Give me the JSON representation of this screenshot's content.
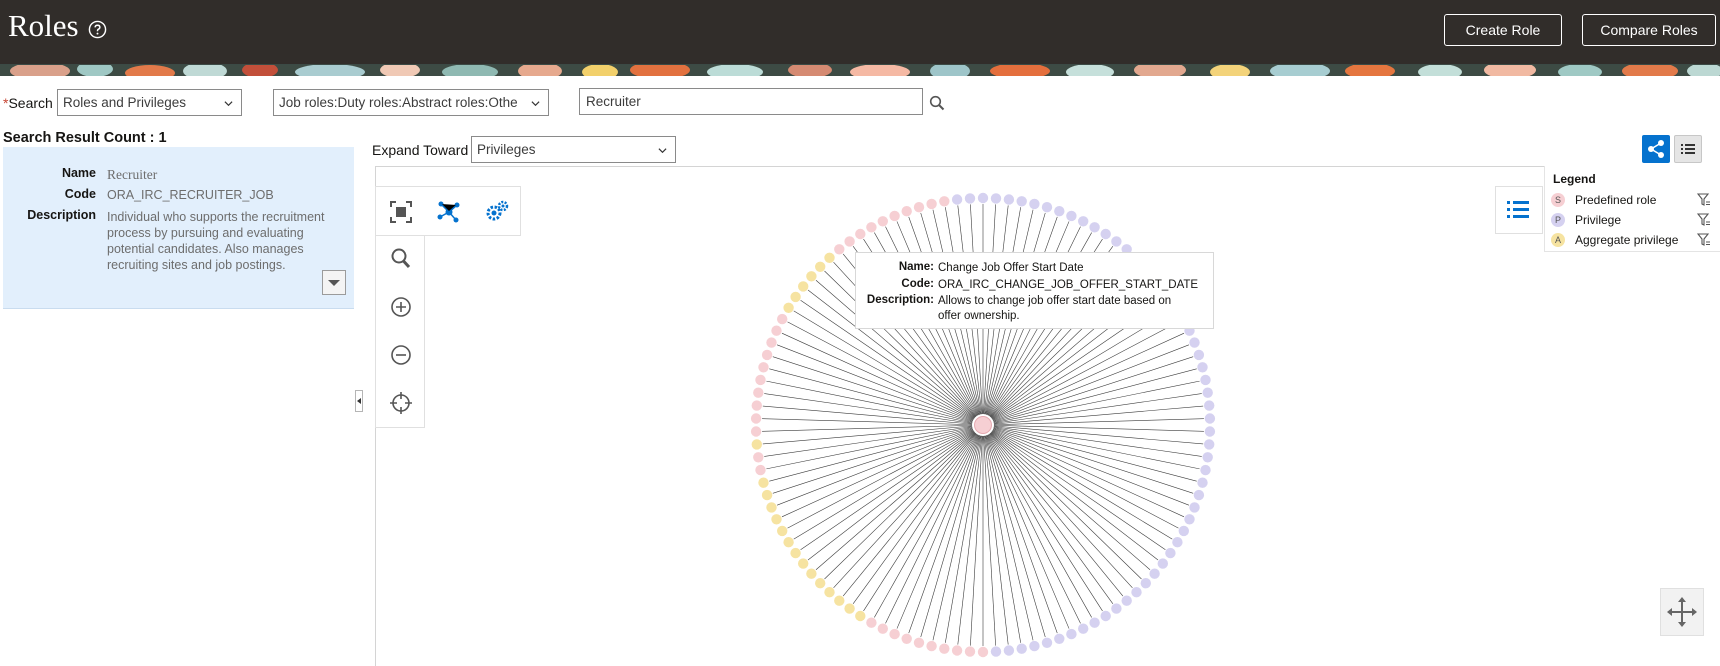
{
  "header": {
    "title": "Roles",
    "create_role": "Create Role",
    "compare_roles": "Compare Roles"
  },
  "search": {
    "required_marker": "*",
    "label": "Search",
    "type_value": "Roles and Privileges",
    "roles_filter_value": "Job roles:Duty roles:Abstract roles:Othe",
    "query_value": "Recruiter"
  },
  "results": {
    "count_label": "Search Result Count : 1",
    "name_label": "Name",
    "name_value": "Recruiter",
    "code_label": "Code",
    "code_value": "ORA_IRC_RECRUITER_JOB",
    "description_label": "Description",
    "description_lines": [
      "Individual who supports the recruitment",
      "process by pursuing and evaluating",
      "potential candidates. Also manages",
      "recruiting sites and job postings."
    ]
  },
  "graph": {
    "expand_label": "Expand Toward",
    "expand_value": "Privileges",
    "node_colors": {
      "role": "#f6cfd3",
      "privilege": "#d5d1f0",
      "aggregate": "#f6e3a1",
      "edge": "#3c3c3c"
    }
  },
  "tooltip": {
    "name_label": "Name:",
    "name_value": "Change Job Offer Start Date",
    "code_label": "Code:",
    "code_value": "ORA_IRC_CHANGE_JOB_OFFER_START_DATE",
    "description_label": "Description:",
    "description_lines": [
      "Allows to change job offer start date based on",
      "offer ownership."
    ]
  },
  "legend": {
    "title": "Legend",
    "items": [
      {
        "letter": "S",
        "label": "Predefined role",
        "color": "#f6cfd3"
      },
      {
        "letter": "P",
        "label": "Privilege",
        "color": "#d5d1f0"
      },
      {
        "letter": "A",
        "label": "Aggregate privilege",
        "color": "#f6e3a1"
      }
    ]
  }
}
